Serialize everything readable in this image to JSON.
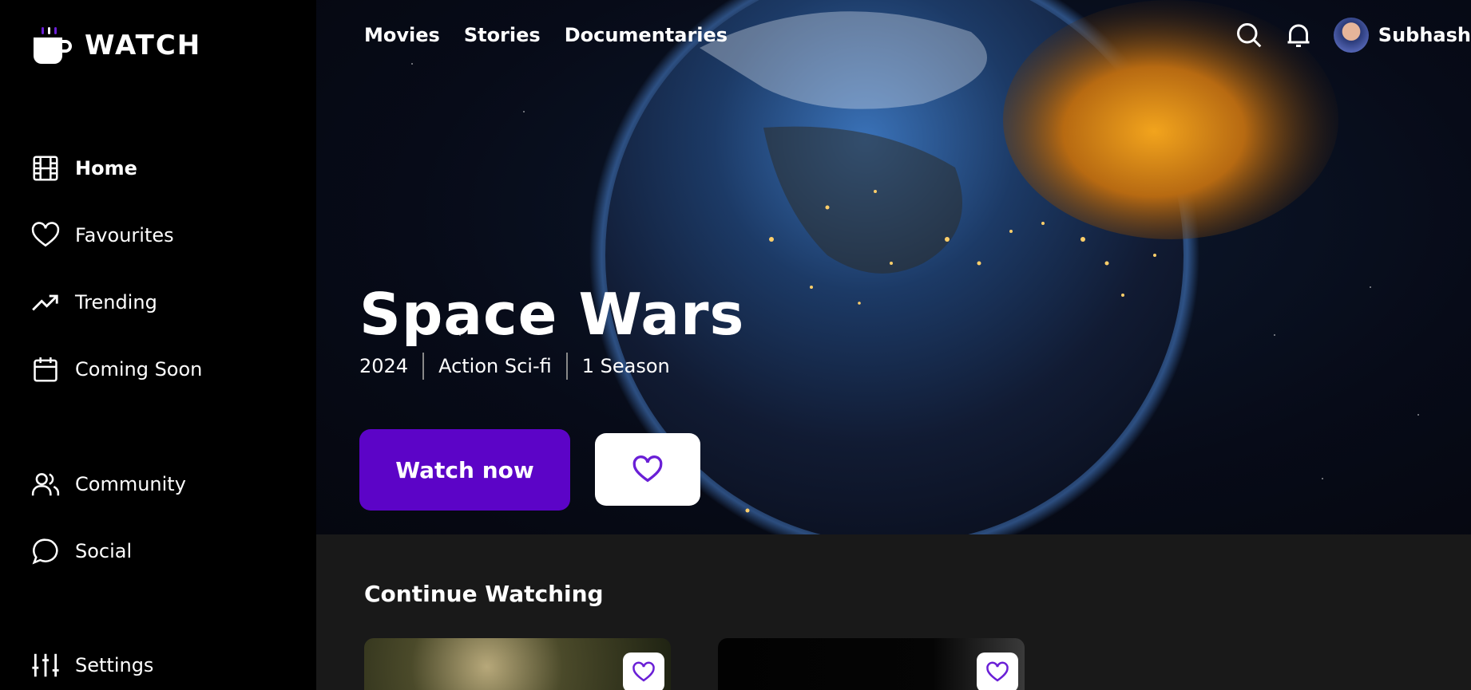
{
  "app": {
    "title": "WATCH"
  },
  "sidebar": {
    "items": [
      {
        "label": "Home",
        "icon": "film-icon",
        "active": true
      },
      {
        "label": "Favourites",
        "icon": "heart-icon"
      },
      {
        "label": "Trending",
        "icon": "trending-up-icon"
      },
      {
        "label": "Coming Soon",
        "icon": "calendar-icon"
      },
      {
        "label": "Community",
        "icon": "users-icon"
      },
      {
        "label": "Social",
        "icon": "chat-bubble-icon"
      },
      {
        "label": "Settings",
        "icon": "sliders-icon"
      }
    ]
  },
  "topnav": {
    "items": [
      "Movies",
      "Stories",
      "Documentaries"
    ]
  },
  "header": {
    "user_name": "Subhash",
    "search_icon": "search-icon",
    "bell_icon": "bell-icon"
  },
  "hero": {
    "title": "Space Wars",
    "year": "2024",
    "genre": "Action Sci-fi",
    "seasons": "1 Season",
    "watch_label": "Watch now"
  },
  "continue": {
    "title": "Continue Watching"
  },
  "colors": {
    "accent": "#5c04c7",
    "heart": "#6a1fd6",
    "background": "#000000",
    "panel": "#191919"
  }
}
